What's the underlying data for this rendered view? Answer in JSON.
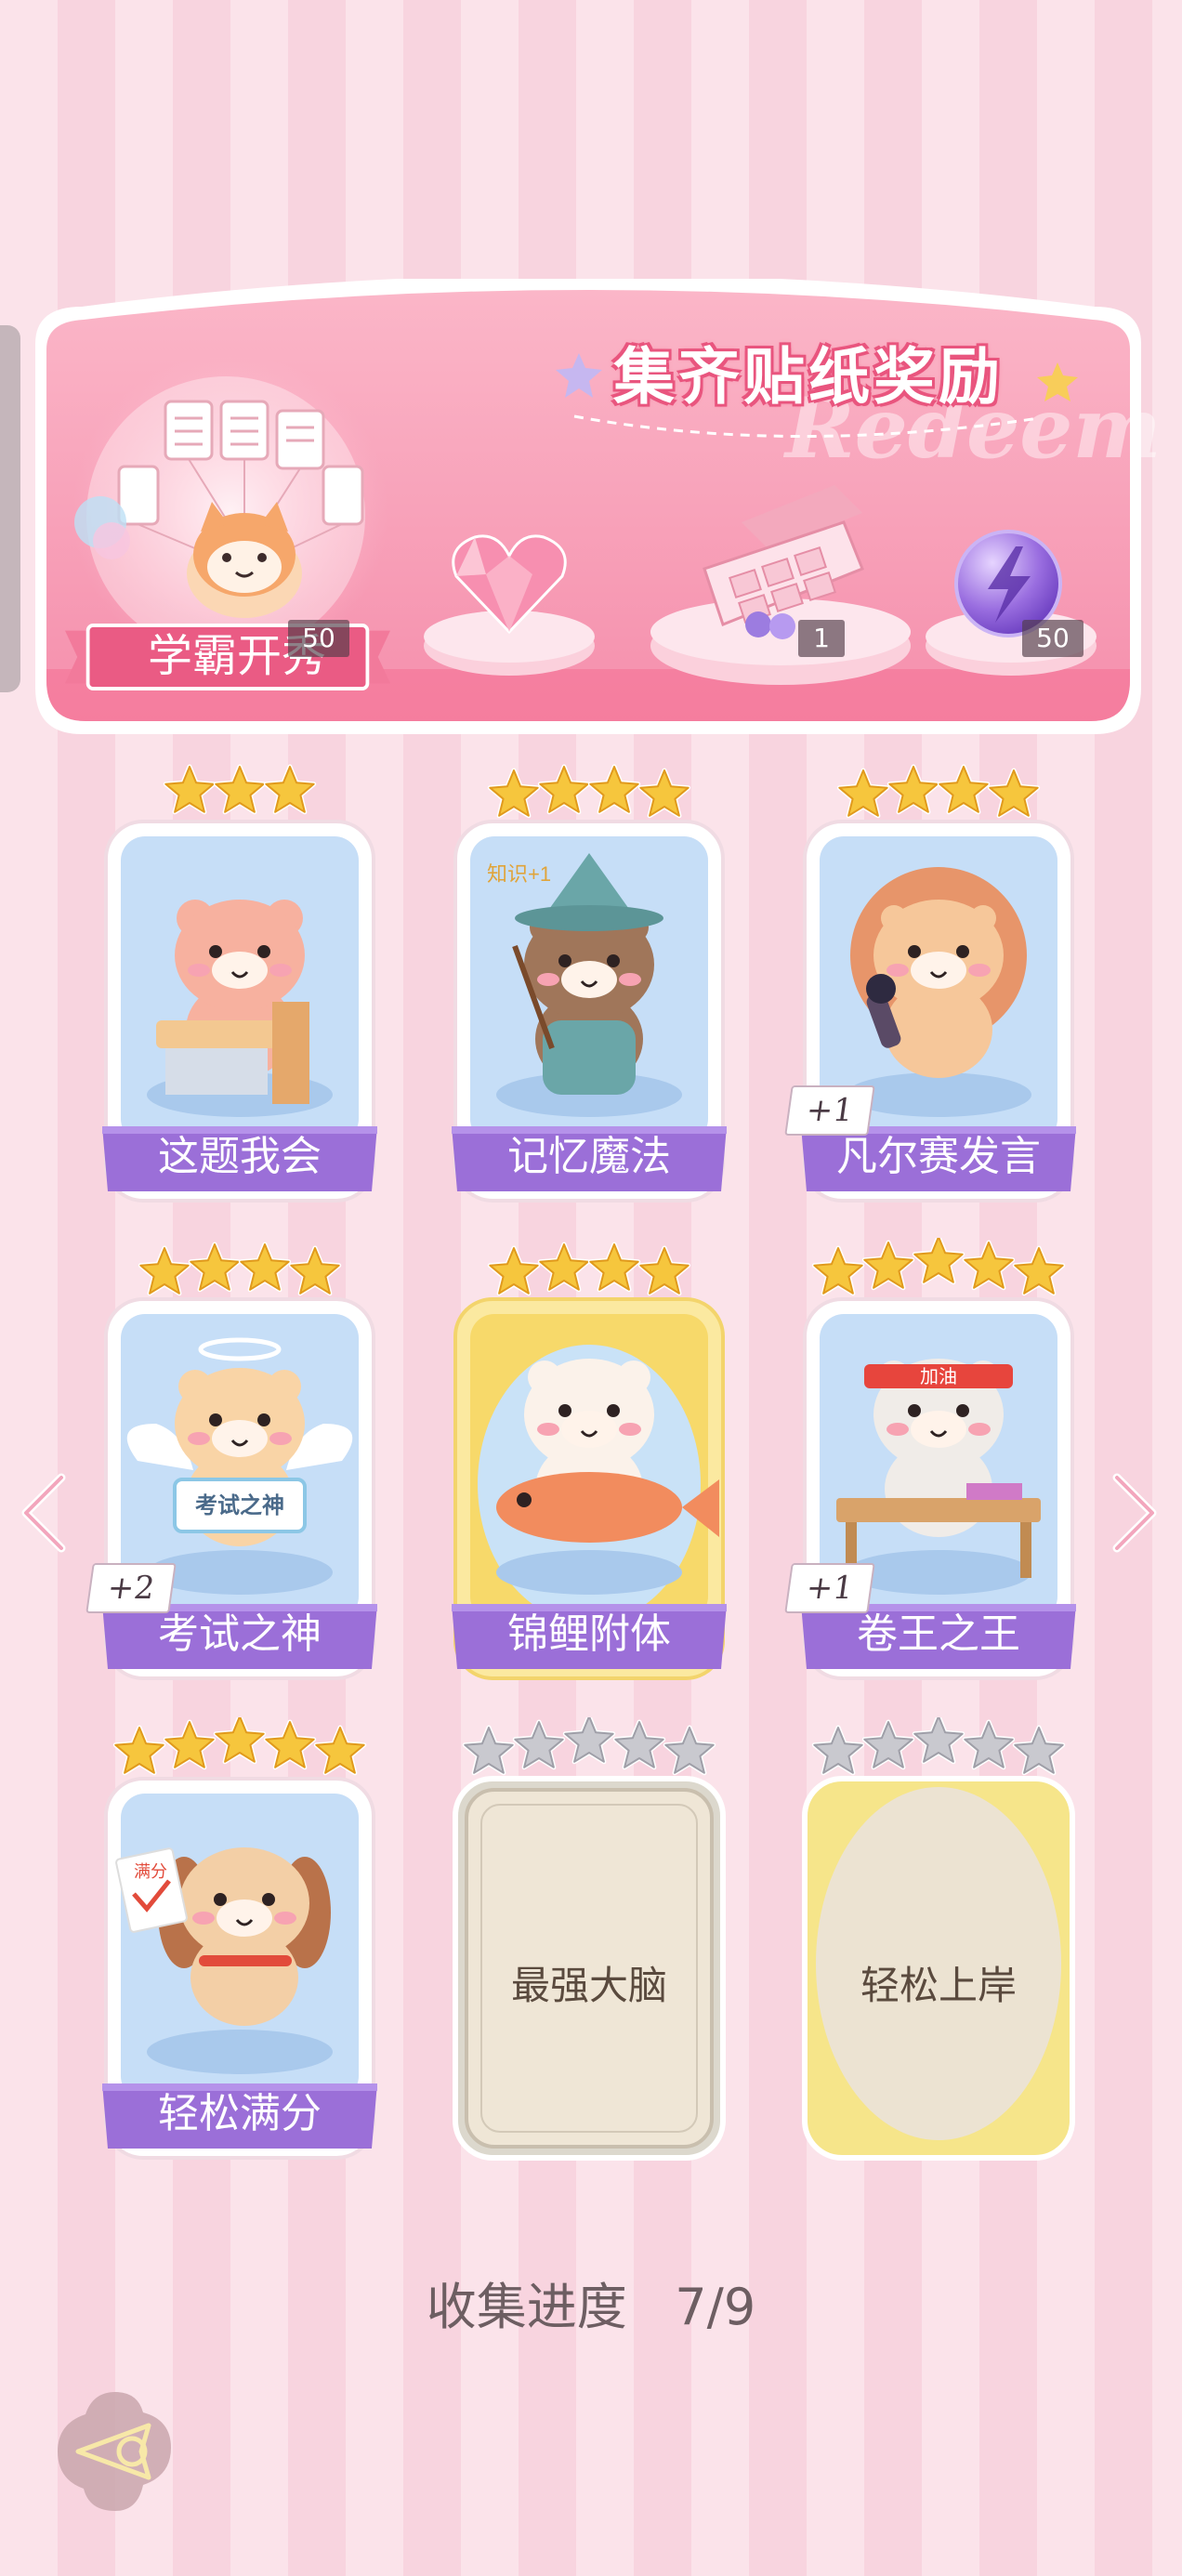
{
  "banner": {
    "title": "集齐贴纸奖励",
    "watermark": "Redeem",
    "badge": "学霸开秀",
    "rewards": [
      {
        "icon": "pink-heart-gem-icon",
        "quantity": "50"
      },
      {
        "icon": "gift-box-icon",
        "quantity": "1"
      },
      {
        "icon": "purple-lightning-orb-icon",
        "quantity": "50"
      }
    ]
  },
  "stickers": [
    {
      "label": "这题我会",
      "stars": 3,
      "bonus": "",
      "style": "normal",
      "icon": "bear-at-desk-icon"
    },
    {
      "label": "记忆魔法",
      "stars": 4,
      "bonus": "",
      "style": "normal",
      "icon": "wizard-otter-icon"
    },
    {
      "label": "凡尔赛发言",
      "stars": 4,
      "bonus": "+1",
      "style": "normal",
      "icon": "lion-microphone-icon"
    },
    {
      "label": "考试之神",
      "stars": 4,
      "bonus": "+2",
      "style": "normal",
      "icon": "angel-cat-icon"
    },
    {
      "label": "锦鲤附体",
      "stars": 4,
      "bonus": "",
      "style": "gold",
      "icon": "bear-with-koi-icon"
    },
    {
      "label": "卷王之王",
      "stars": 5,
      "bonus": "+1",
      "style": "normal",
      "icon": "studying-cat-icon"
    },
    {
      "label": "轻松满分",
      "stars": 5,
      "bonus": "",
      "style": "normal",
      "icon": "puppy-full-score-icon"
    },
    {
      "label": "最强大脑",
      "stars": 5,
      "bonus": "",
      "style": "locked",
      "icon": ""
    },
    {
      "label": "轻松上岸",
      "stars": 5,
      "bonus": "",
      "style": "locked-gold",
      "icon": ""
    }
  ],
  "sticker_badge_text": {
    "kaoshi": "考试之神",
    "jiayou": "加油",
    "manfen": "满分",
    "zhishi": "知识+1"
  },
  "progress": {
    "label": "收集进度",
    "value": "7/9",
    "collected": 7,
    "total": 9
  },
  "colors": {
    "label_purple": "#9a6fd6",
    "banner_pink": "#f06a90",
    "star_gold": "#f5c33b"
  }
}
